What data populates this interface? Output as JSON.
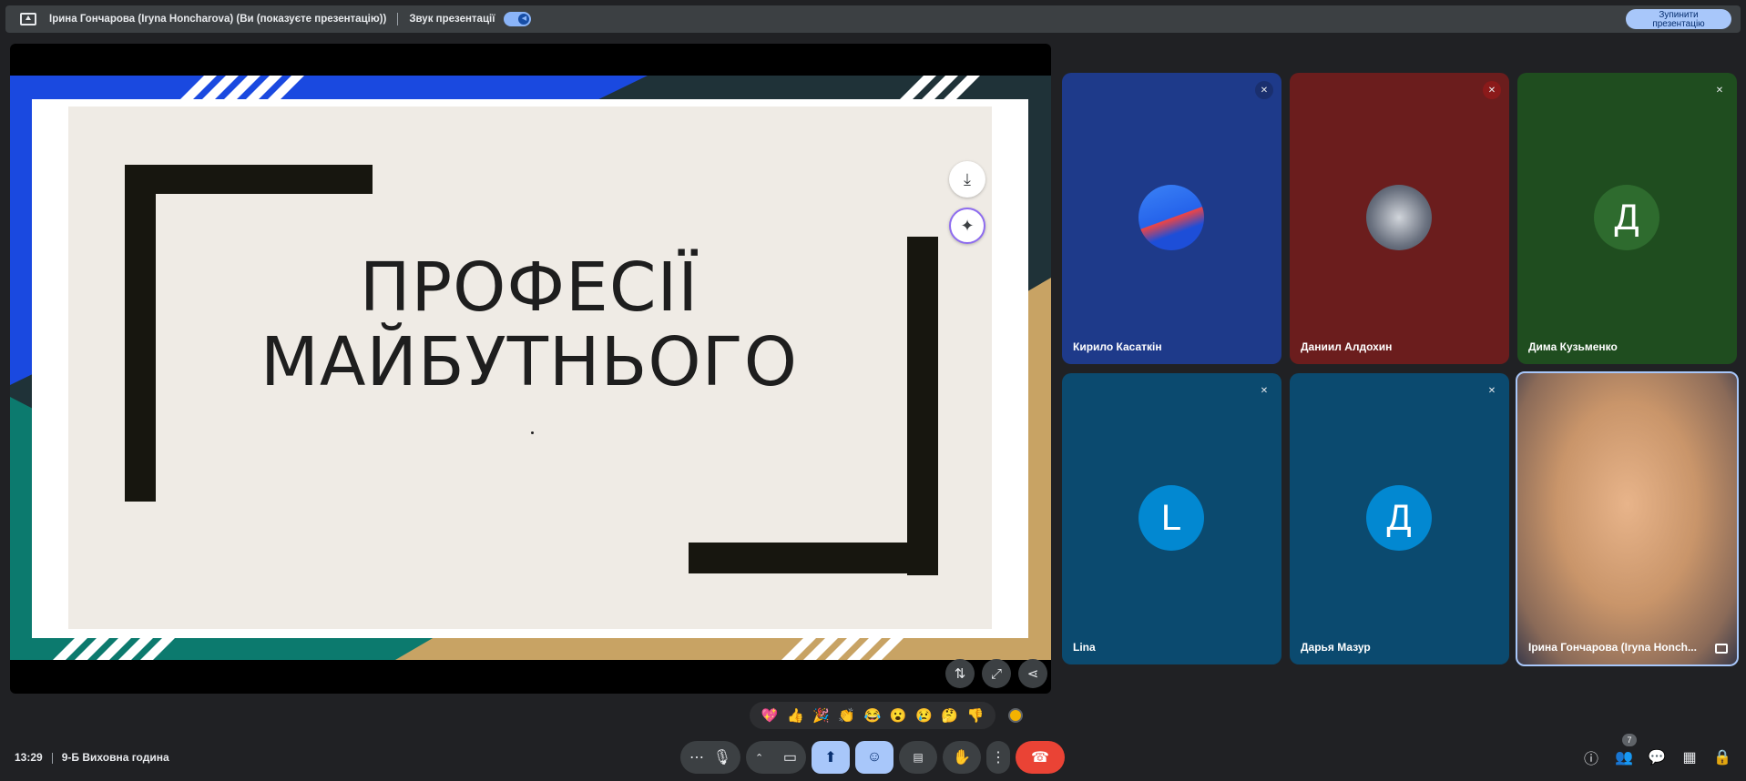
{
  "topbar": {
    "presenter": "Ірина Гончарова (Iryna Honcharova) (Ви (показуєте презентацію))",
    "sound_label": "Звук презентації",
    "stop_line1": "Зупинити",
    "stop_line2": "презентацію"
  },
  "slide": {
    "title_line1": "ПРОФЕСІЇ",
    "title_line2": "МАЙБУТНЬОГО"
  },
  "participants": [
    {
      "name": "Кирило Касаткін",
      "avatar": "",
      "color": "#1e3a8a"
    },
    {
      "name": "Даниил Алдохин",
      "avatar": "",
      "color": "#6b1d1d"
    },
    {
      "name": "Дима Кузьменко",
      "avatar": "Д",
      "color": "#1f4d1f"
    },
    {
      "name": "Lina",
      "avatar": "L",
      "color": "#0b4a6f"
    },
    {
      "name": "Дарья Мазур",
      "avatar": "Д",
      "color": "#0b4a6f"
    },
    {
      "name": "Ірина Гончарова (Iryna Honch...",
      "avatar": "",
      "color": "#c79a6e"
    }
  ],
  "reactions": [
    "💖",
    "👍",
    "🎉",
    "👏",
    "😂",
    "😮",
    "😢",
    "🤔",
    "👎"
  ],
  "meeting": {
    "time": "13:29",
    "title": "9-Б Виховна година",
    "people_count": "7"
  },
  "colors": {
    "accent": "#a8c7fa",
    "end_call": "#ea4335"
  }
}
